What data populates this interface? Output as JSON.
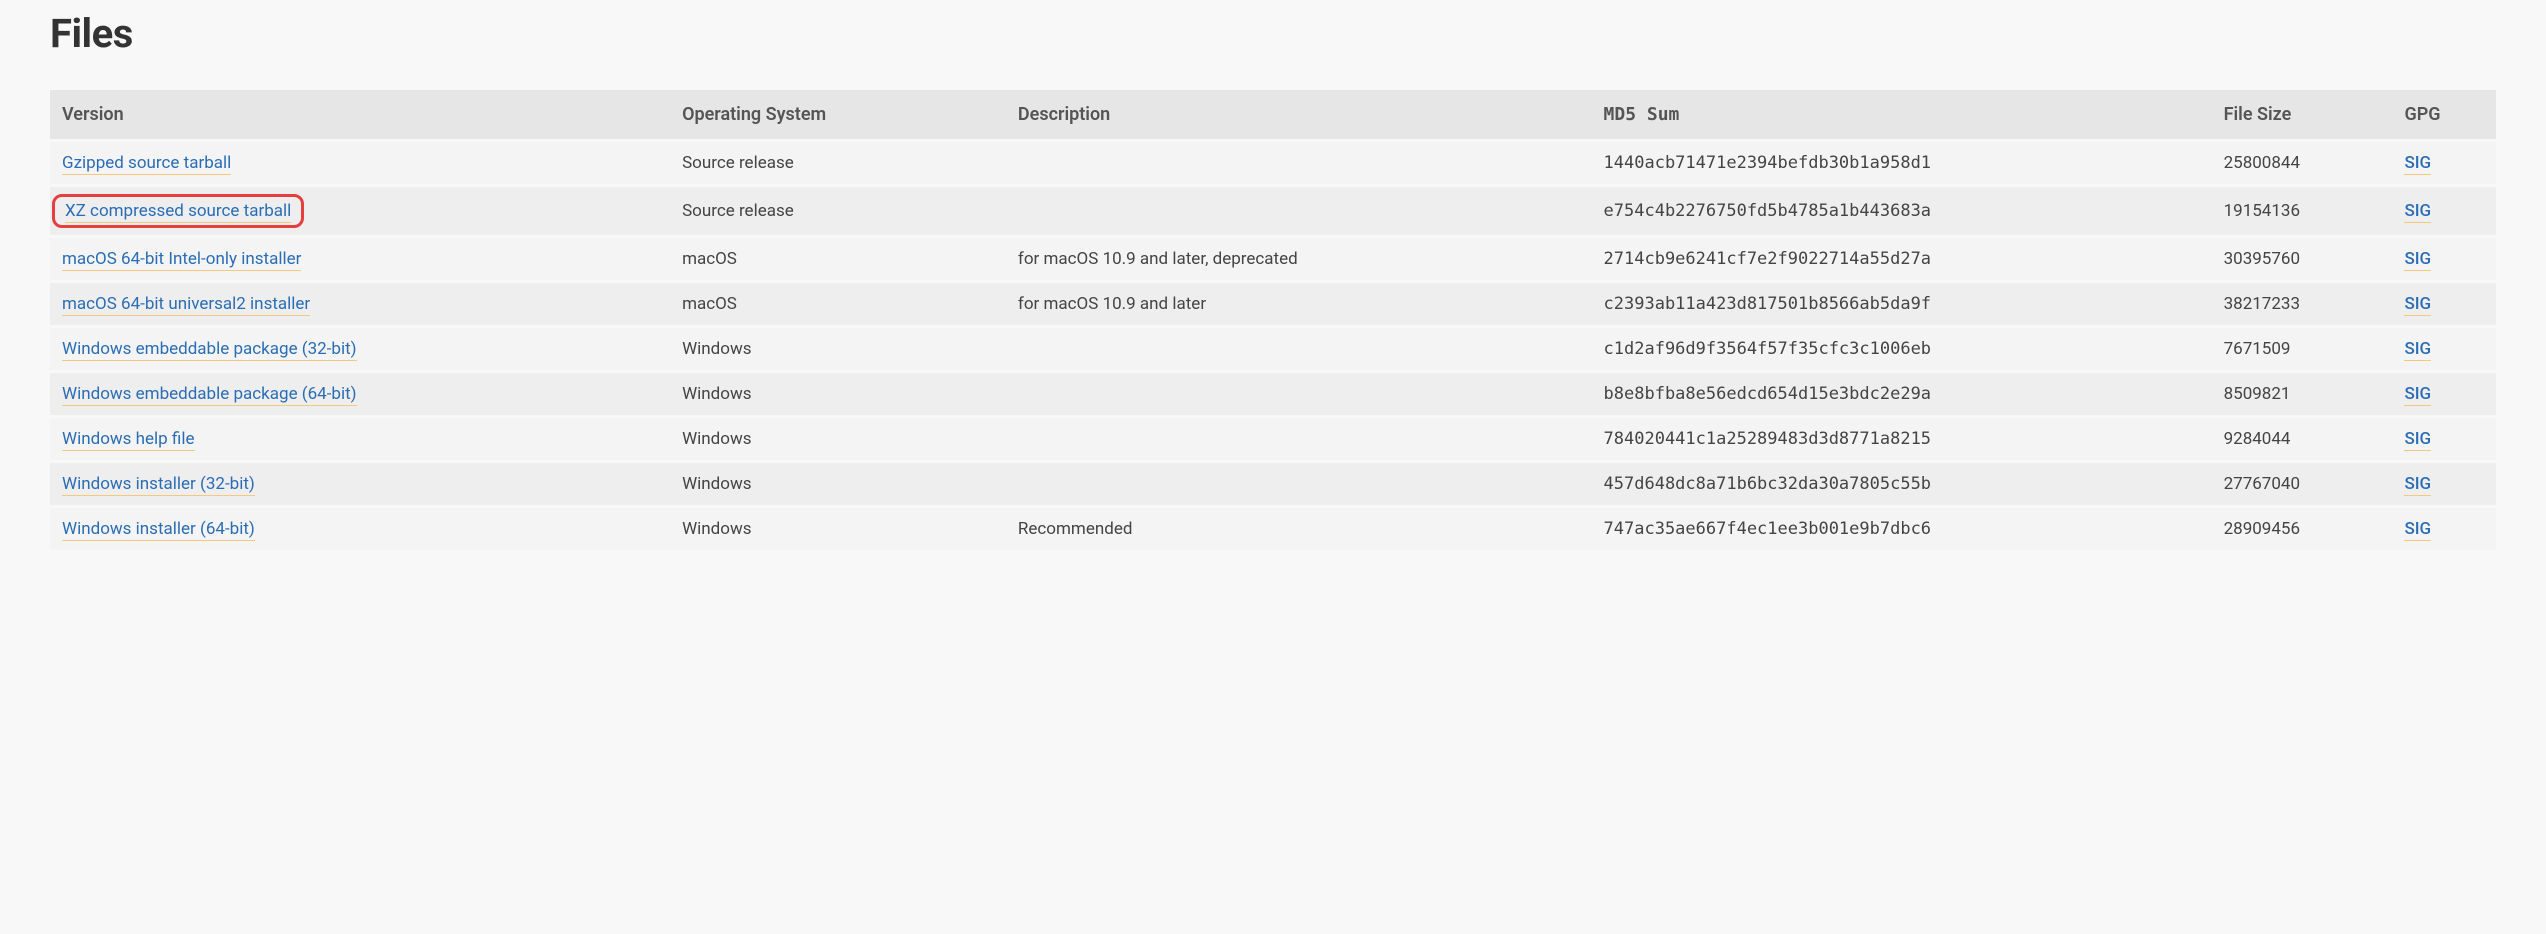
{
  "title": "Files",
  "columns": [
    "Version",
    "Operating System",
    "Description",
    "MD5 Sum",
    "File Size",
    "GPG"
  ],
  "sig_label": "SIG",
  "rows": [
    {
      "version": "Gzipped source tarball",
      "os": "Source release",
      "description": "",
      "md5": "1440acb71471e2394befdb30b1a958d1",
      "size": "25800844",
      "highlighted": false
    },
    {
      "version": "XZ compressed source tarball",
      "os": "Source release",
      "description": "",
      "md5": "e754c4b2276750fd5b4785a1b443683a",
      "size": "19154136",
      "highlighted": true
    },
    {
      "version": "macOS 64-bit Intel-only installer",
      "os": "macOS",
      "description": "for macOS 10.9 and later, deprecated",
      "md5": "2714cb9e6241cf7e2f9022714a55d27a",
      "size": "30395760",
      "highlighted": false
    },
    {
      "version": "macOS 64-bit universal2 installer",
      "os": "macOS",
      "description": "for macOS 10.9 and later",
      "md5": "c2393ab11a423d817501b8566ab5da9f",
      "size": "38217233",
      "highlighted": false
    },
    {
      "version": "Windows embeddable package (32-bit)",
      "os": "Windows",
      "description": "",
      "md5": "c1d2af96d9f3564f57f35cfc3c1006eb",
      "size": "7671509",
      "highlighted": false
    },
    {
      "version": "Windows embeddable package (64-bit)",
      "os": "Windows",
      "description": "",
      "md5": "b8e8bfba8e56edcd654d15e3bdc2e29a",
      "size": "8509821",
      "highlighted": false
    },
    {
      "version": "Windows help file",
      "os": "Windows",
      "description": "",
      "md5": "784020441c1a25289483d3d8771a8215",
      "size": "9284044",
      "highlighted": false
    },
    {
      "version": "Windows installer (32-bit)",
      "os": "Windows",
      "description": "",
      "md5": "457d648dc8a71b6bc32da30a7805c55b",
      "size": "27767040",
      "highlighted": false
    },
    {
      "version": "Windows installer (64-bit)",
      "os": "Windows",
      "description": "Recommended",
      "md5": "747ac35ae667f4ec1ee3b001e9b7dbc6",
      "size": "28909456",
      "highlighted": false
    }
  ]
}
